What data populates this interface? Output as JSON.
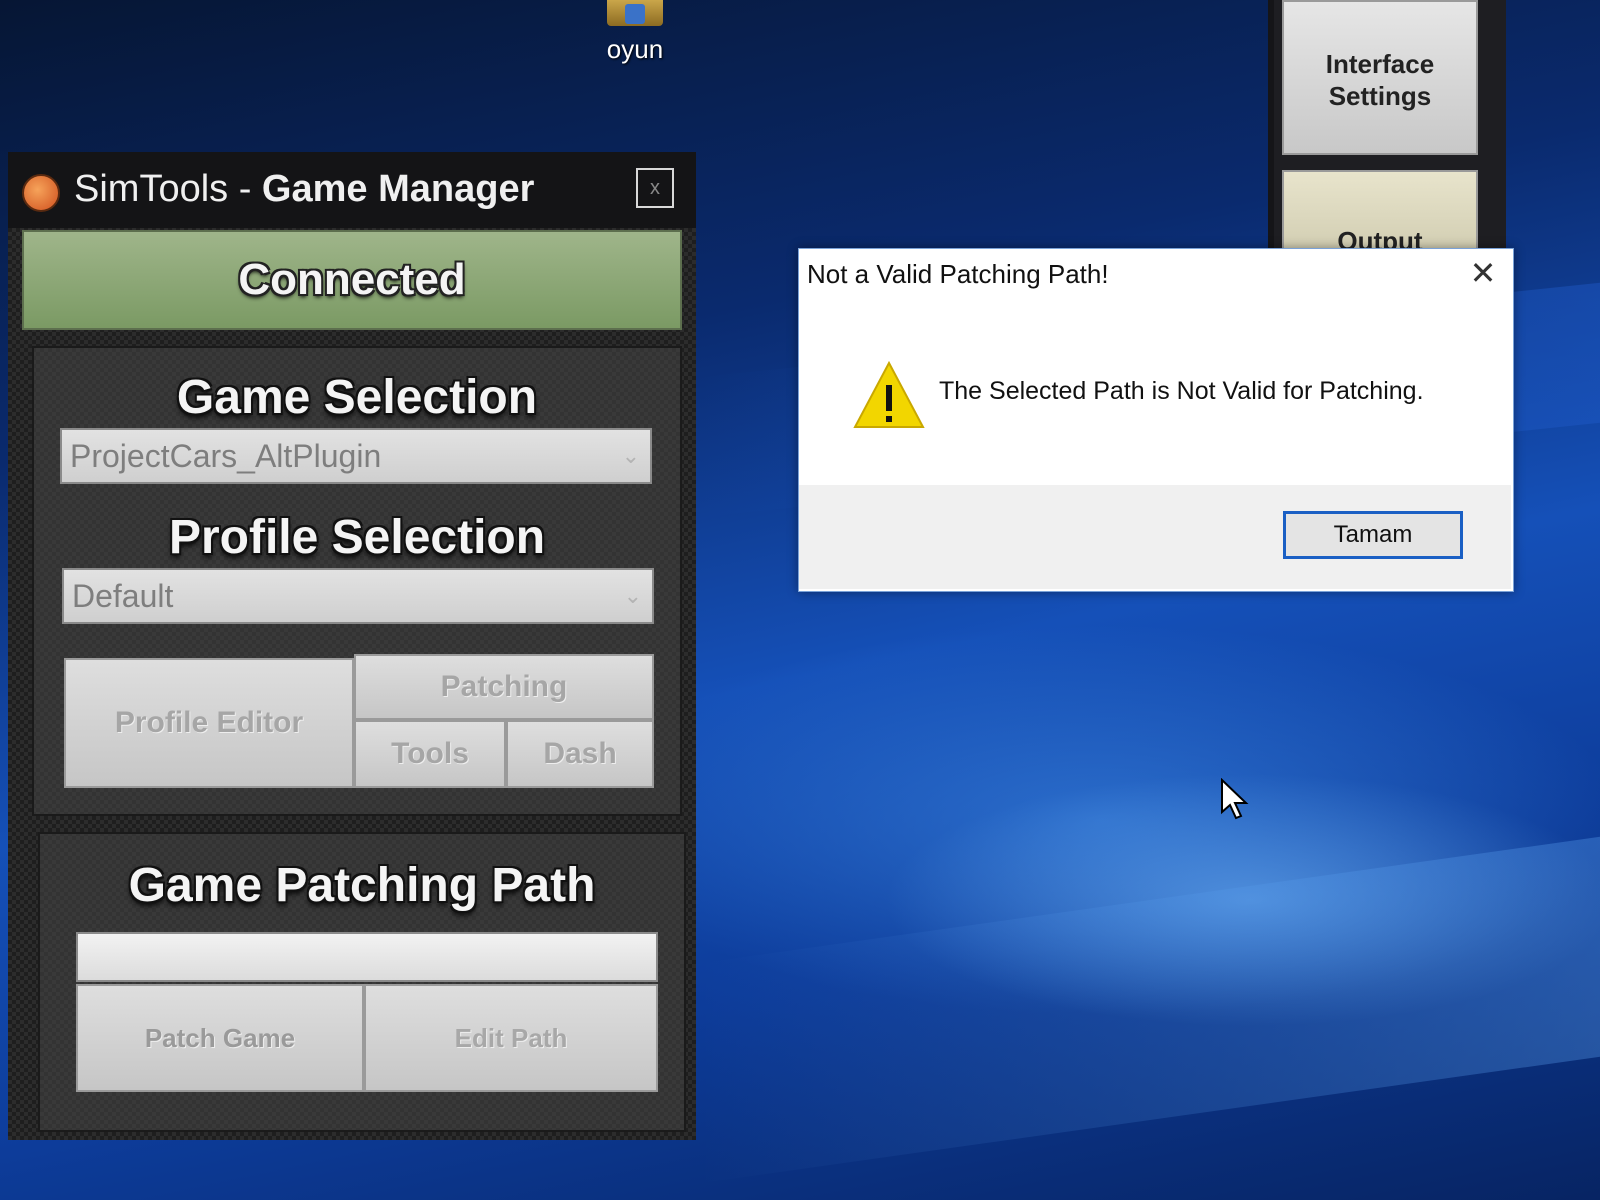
{
  "desktop": {
    "icon_label": "oyun"
  },
  "background_app": {
    "interface_settings_label": "Interface\nSettings",
    "output_label": "Output"
  },
  "simtools": {
    "title_prefix": "SimTools - ",
    "title_bold": "Game Manager",
    "close_glyph": "x",
    "status": "Connected",
    "game_selection": {
      "heading": "Game Selection",
      "selected": "ProjectCars_AltPlugin"
    },
    "profile_selection": {
      "heading": "Profile Selection",
      "selected": "Default"
    },
    "buttons": {
      "profile_editor": "Profile Editor",
      "patching": "Patching",
      "tools": "Tools",
      "dash": "Dash"
    },
    "patching_path": {
      "heading": "Game Patching Path",
      "value": "",
      "patch_game": "Patch Game",
      "edit_path": "Edit Path"
    }
  },
  "dialog": {
    "title": "Not a Valid Patching Path!",
    "close_glyph": "✕",
    "message": "The Selected Path is Not Valid for Patching.",
    "ok_label": "Tamam"
  },
  "colors": {
    "connected_bg": "#8ca876",
    "dialog_ok_border": "#1a5fc4",
    "warning_yellow": "#f2d600"
  }
}
